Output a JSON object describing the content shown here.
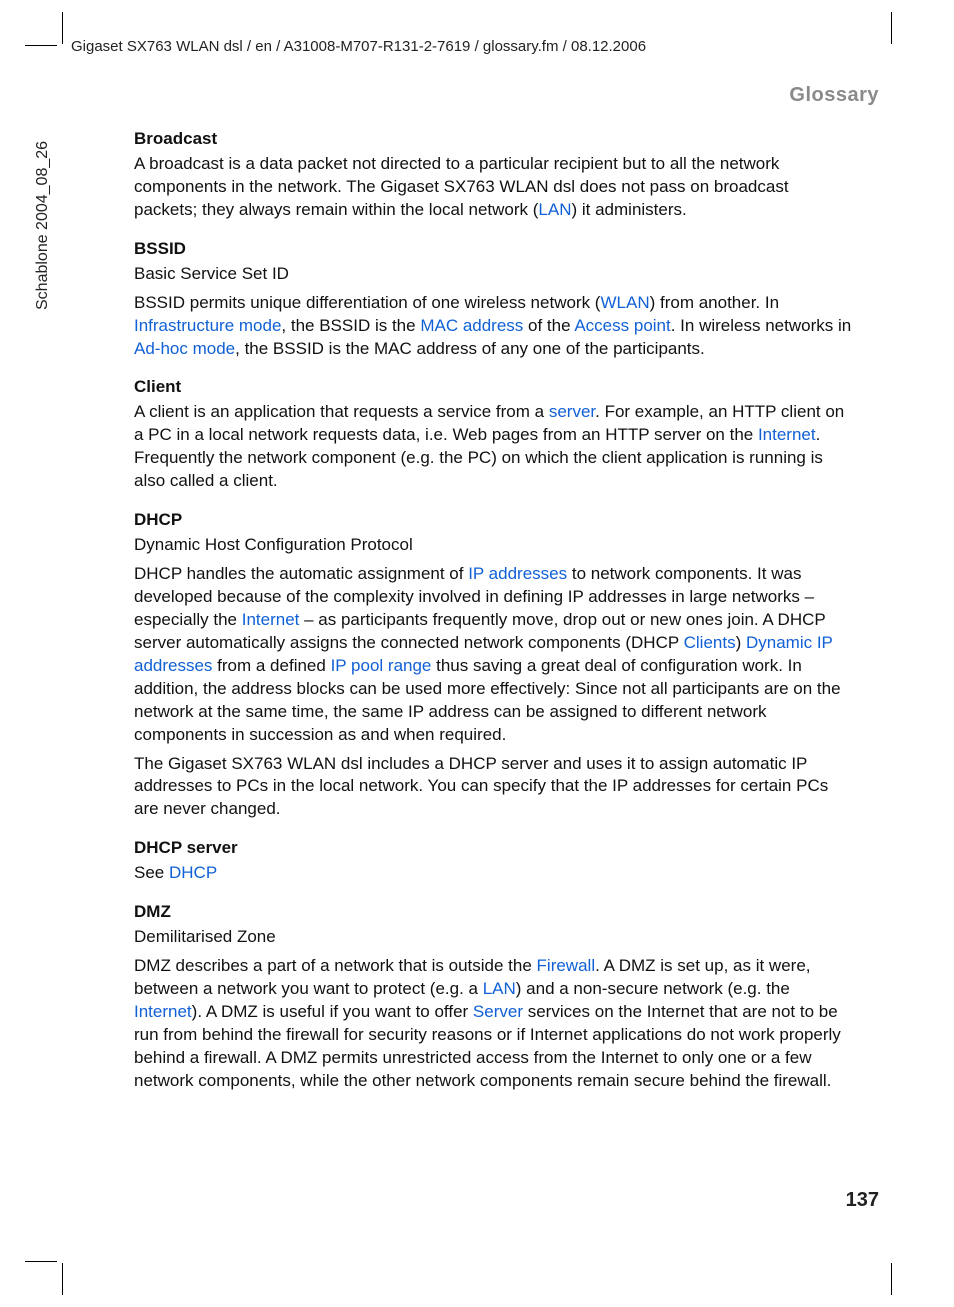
{
  "header": "Gigaset SX763 WLAN dsl / en / A31008-M707-R131-2-7619 / glossary.fm / 08.12.2006",
  "section": "Glossary",
  "side": "Schablone 2004_08_26",
  "pageNumber": "137",
  "entries": {
    "broadcast": {
      "term": "Broadcast",
      "p1a": "A broadcast is a data packet not directed to a particular recipient but to all the network components in the network. The Gigaset SX763 WLAN dsl does not pass on broadcast packets; they always remain within the local network (",
      "link1": "LAN",
      "p1b": ") it administers."
    },
    "bssid": {
      "term": "BSSID",
      "sub": "Basic Service Set ID",
      "p1a": "BSSID permits unique differentiation of one wireless network (",
      "link1": "WLAN",
      "p1b": ") from another. In ",
      "link2": "Infrastructure mode",
      "p1c": ", the BSSID is the ",
      "link3": "MAC address",
      "p1d": " of the ",
      "link4": "Access point",
      "p1e": ". In wireless networks in ",
      "link5": "Ad-hoc mode",
      "p1f": ", the BSSID is the MAC address of any one of the participants."
    },
    "client": {
      "term": "Client",
      "p1a": "A client is an application that requests a service from a ",
      "link1": "server",
      "p1b": ". For example, an HTTP client on a PC in a local network requests data, i.e. Web pages from an HTTP server on the ",
      "link2": "Internet",
      "p1c": ". Frequently the network component (e.g. the PC) on which the client application is running is also called a client."
    },
    "dhcp": {
      "term": "DHCP",
      "sub": "Dynamic Host Configuration Protocol",
      "p1a": "DHCP handles the automatic assignment of ",
      "link1": "IP addresses",
      "p1b": " to network components. It was developed because of the complexity involved in defining IP addresses in large networks – especially the ",
      "link2": "Internet",
      "p1c": " – as participants frequently move, drop out or new ones join. A DHCP server automatically assigns the connected network components (DHCP ",
      "link3": "Clients",
      "p1d": ") ",
      "link4": "Dynamic IP addresses",
      "p1e": " from a defined ",
      "link5": "IP pool range",
      "p1f": " thus saving a great deal of configuration work. In addition, the address blocks can be used more effectively: Since not all participants are on the network at the same time, the same IP address can be assigned to different network components in succession as and when required.",
      "p2": "The Gigaset SX763 WLAN dsl includes a DHCP server and uses it to assign automatic IP addresses to PCs in the local network. You can specify that the IP addresses for certain PCs are never changed."
    },
    "dhcpserver": {
      "term": "DHCP server",
      "p1a": "See ",
      "link1": "DHCP"
    },
    "dmz": {
      "term": "DMZ",
      "sub": "Demilitarised Zone",
      "p1a": "DMZ describes a part of a network that is outside the ",
      "link1": "Firewall",
      "p1b": ". A DMZ is set up, as it were, between a network you want to protect (e.g. a ",
      "link2": "LAN",
      "p1c": ") and a non-secure network (e.g. the ",
      "link3": "Internet",
      "p1d": "). A DMZ is useful if you want to offer ",
      "link4": "Server",
      "p1e": " services on the Internet that are not to be run from behind the firewall for security reasons or if Internet applications do not work properly behind a firewall. A DMZ permits unrestricted access from the Internet to only one or a few network components, while the other network components remain secure behind the firewall."
    }
  }
}
